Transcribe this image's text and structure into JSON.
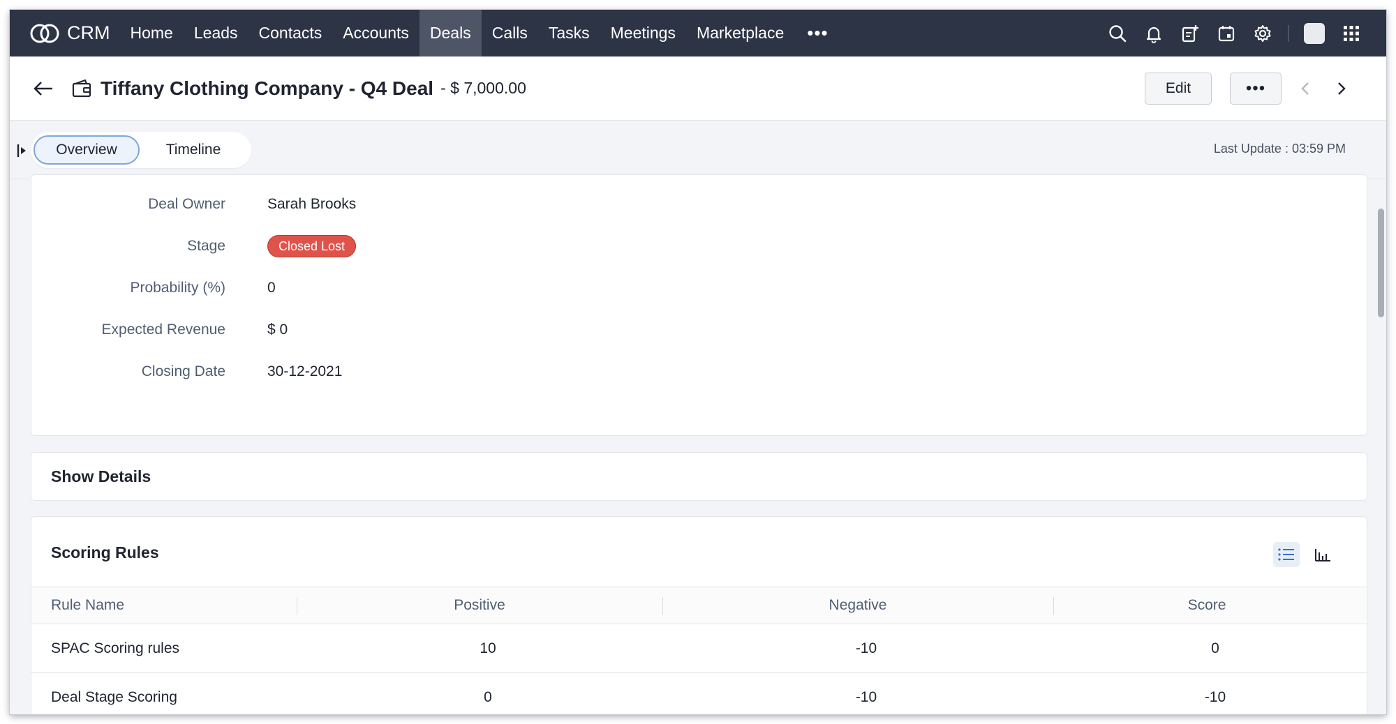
{
  "app": {
    "brand": "CRM"
  },
  "nav": {
    "items": [
      {
        "label": "Home"
      },
      {
        "label": "Leads"
      },
      {
        "label": "Contacts"
      },
      {
        "label": "Accounts"
      },
      {
        "label": "Deals",
        "active": true
      },
      {
        "label": "Calls"
      },
      {
        "label": "Tasks"
      },
      {
        "label": "Meetings"
      },
      {
        "label": "Marketplace"
      }
    ],
    "more": "•••",
    "icons": [
      "search-icon",
      "bell-icon",
      "add-record-icon",
      "calendar-icon",
      "gear-icon",
      "avatar",
      "apps-grid-icon"
    ]
  },
  "record": {
    "title": "Tiffany Clothing Company - Q4 Deal",
    "amount": "- $ 7,000.00",
    "edit_label": "Edit",
    "more_label": "•••"
  },
  "tabs": {
    "overview": "Overview",
    "timeline": "Timeline",
    "last_update": "Last Update : 03:59 PM"
  },
  "overview": {
    "fields": [
      {
        "label": "Deal Owner",
        "value": "Sarah Brooks"
      },
      {
        "label": "Stage",
        "value": "Closed Lost"
      },
      {
        "label": "Probability (%)",
        "value": "0"
      },
      {
        "label": "Expected Revenue",
        "value": "$ 0"
      },
      {
        "label": "Closing Date",
        "value": "30-12-2021"
      }
    ]
  },
  "details": {
    "title": "Show Details"
  },
  "scoring": {
    "title": "Scoring Rules",
    "columns": [
      "Rule Name",
      "Positive",
      "Negative",
      "Score"
    ],
    "rows": [
      {
        "name": "SPAC Scoring rules",
        "positive": "10",
        "negative": "-10",
        "score": "0"
      },
      {
        "name": "Deal Stage Scoring",
        "positive": "0",
        "negative": "-10",
        "score": "-10"
      }
    ]
  },
  "colors": {
    "topbar": "#2c3445",
    "active_nav": "#4d5566",
    "stage_badge": "#e0534b",
    "accent": "#7fa6d9"
  }
}
